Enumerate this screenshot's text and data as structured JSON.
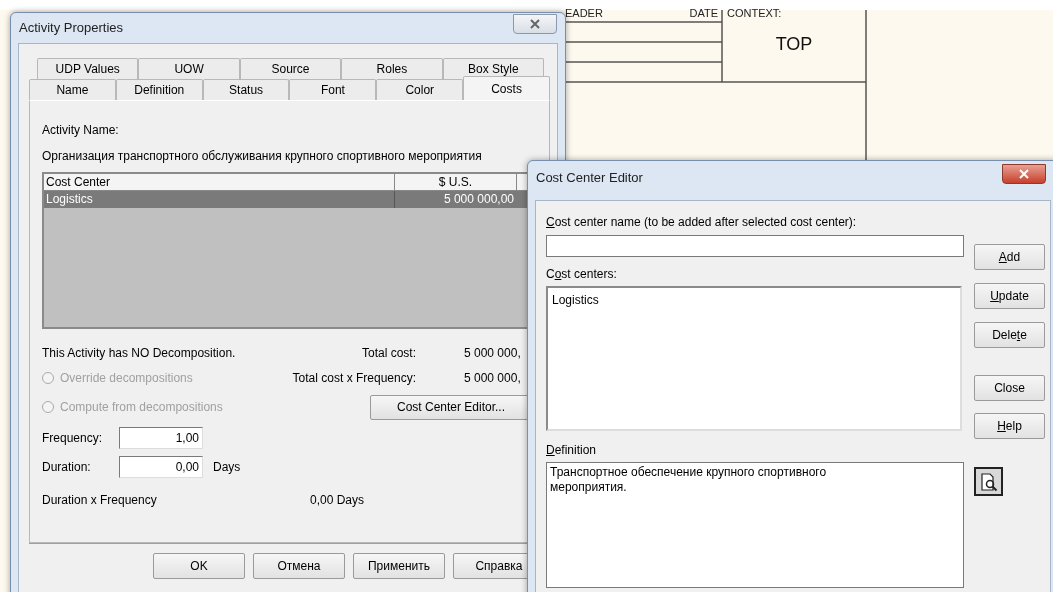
{
  "canvas": {
    "header_labels": [
      "EADER",
      "DATE",
      "CONTEXT:"
    ],
    "context": "TOP"
  },
  "activity_properties": {
    "title": "Activity Properties",
    "tab_rows": [
      [
        {
          "label": "UDP Values",
          "selected": false
        },
        {
          "label": "UOW",
          "selected": false
        },
        {
          "label": "Source",
          "selected": false
        },
        {
          "label": "Roles",
          "selected": false
        },
        {
          "label": "Box Style",
          "selected": false
        }
      ],
      [
        {
          "label": "Name",
          "selected": false
        },
        {
          "label": "Definition",
          "selected": false
        },
        {
          "label": "Status",
          "selected": false
        },
        {
          "label": "Font",
          "selected": false
        },
        {
          "label": "Color",
          "selected": false
        },
        {
          "label": "Costs",
          "selected": true
        }
      ]
    ],
    "activity_name_label": "Activity Name:",
    "activity_name": "Организация транспортного обслуживания крупного спортивного мероприятия",
    "cost_table": {
      "columns": [
        "Cost Center",
        "$ U.S."
      ],
      "rows": [
        {
          "cells": [
            "Logistics",
            "5 000 000,00"
          ],
          "selected": true
        }
      ]
    },
    "decomposition_note": "This Activity has NO Decomposition.",
    "totals": [
      {
        "label": "Total cost:",
        "value": "5 000 000,"
      },
      {
        "label": "Total cost x Frequency:",
        "value": "5 000 000,"
      }
    ],
    "radios": [
      {
        "label": "Override decompositions",
        "checked": false,
        "disabled": true
      },
      {
        "label": "Compute from decompositions",
        "checked": false,
        "disabled": true
      }
    ],
    "cost_center_editor_button": "Cost Center Editor...",
    "frequency": {
      "label": "Frequency:",
      "value": "1,00"
    },
    "duration": {
      "label": "Duration:",
      "value": "0,00",
      "unit": "Days"
    },
    "duration_x_frequency": {
      "label": "Duration x Frequency",
      "value": "0,00 Days"
    },
    "buttons": [
      "OK",
      "Отмена",
      "Применить",
      "Справка"
    ]
  },
  "cost_center_editor": {
    "title": "Cost Center Editor",
    "name_label": {
      "access_key": "C",
      "after": "ost center name (to be added after selected cost center):"
    },
    "cost_centers_label": {
      "before": "C",
      "access_key": "o",
      "after": "st centers:"
    },
    "cost_centers": [
      {
        "name": "Logistics",
        "selected": false
      }
    ],
    "definition_label": {
      "access_key": "D",
      "after": "efinition"
    },
    "definition": "Транспортное обеспечение крупного спортивного мероприятия.",
    "buttons": [
      {
        "access_key": "A",
        "after": "dd"
      },
      {
        "access_key": "U",
        "after": "pdate"
      },
      {
        "before": "Dele",
        "access_key": "t",
        "after": "e"
      },
      {
        "before": "Close"
      },
      {
        "access_key": "H",
        "after": "elp"
      }
    ]
  }
}
